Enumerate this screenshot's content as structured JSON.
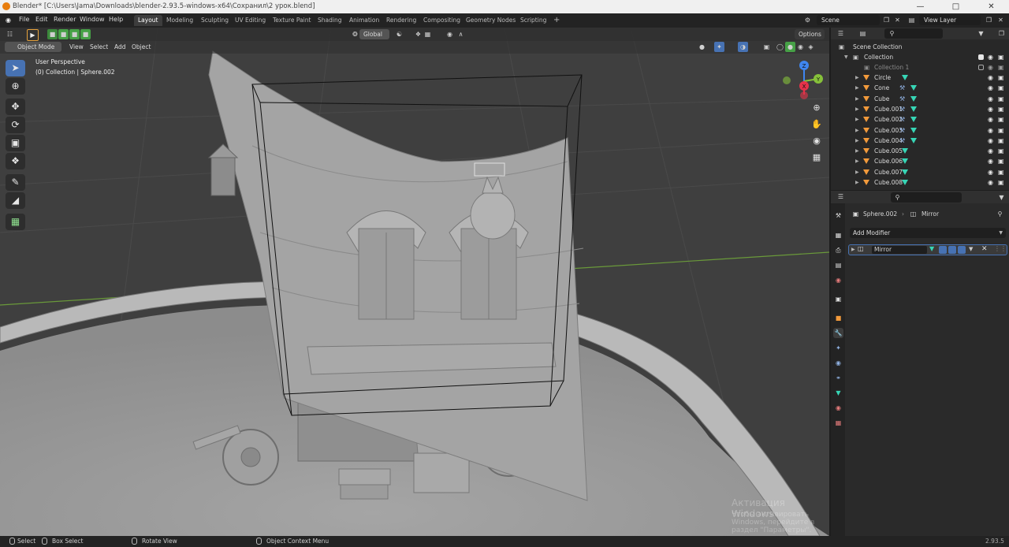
{
  "window": {
    "title": "Blender* [C:\\Users\\Jama\\Downloads\\blender-2.93.5-windows-x64\\Сохранил\\2 урок.blend]"
  },
  "menu": [
    "File",
    "Edit",
    "Render",
    "Window",
    "Help"
  ],
  "workspaces": [
    "Layout",
    "Modeling",
    "Sculpting",
    "UV Editing",
    "Texture Paint",
    "Shading",
    "Animation",
    "Rendering",
    "Compositing",
    "Geometry Nodes",
    "Scripting"
  ],
  "active_workspace": "Layout",
  "add_workspace": "+",
  "scene": {
    "label": "Scene",
    "view_layer": "View Layer"
  },
  "viewport": {
    "transform_orientation": "Global",
    "options_label": "Options",
    "mode": "Object Mode",
    "menus": [
      "View",
      "Select",
      "Add",
      "Object"
    ],
    "info_line1": "User Perspective",
    "info_line2": "(0) Collection | Sphere.002",
    "gizmo": {
      "x": "X",
      "y": "Y",
      "z": "Z"
    },
    "watermark_line1": "Активация Windows",
    "watermark_line2": "Чтобы активировать Windows, перейдите в раздел \"Параметры\"."
  },
  "outliner": {
    "search_placeholder": "",
    "scene_collection": "Scene Collection",
    "collection": "Collection",
    "collection1": "Collection 1",
    "objects": [
      {
        "name": "Circle",
        "modifier": false
      },
      {
        "name": "Cone",
        "modifier": true
      },
      {
        "name": "Cube",
        "modifier": true
      },
      {
        "name": "Cube.001",
        "modifier": true
      },
      {
        "name": "Cube.002",
        "modifier": true
      },
      {
        "name": "Cube.003",
        "modifier": true
      },
      {
        "name": "Cube.004",
        "modifier": true
      },
      {
        "name": "Cube.005",
        "modifier": false
      },
      {
        "name": "Cube.006",
        "modifier": false
      },
      {
        "name": "Cube.007",
        "modifier": false
      },
      {
        "name": "Cube.008",
        "modifier": false
      }
    ]
  },
  "properties": {
    "object_name": "Sphere.002",
    "modifier_context": "Mirror",
    "add_modifier": "Add Modifier",
    "modifier_name": "Mirror"
  },
  "statusbar": {
    "select": "Select",
    "box_select": "Box Select",
    "rotate_view": "Rotate View",
    "context_menu": "Object Context Menu",
    "version": "2.93.5"
  },
  "colors": {
    "accent": "#4772b3",
    "object_orange": "#f29a3b",
    "mesh_teal": "#37d6b6",
    "axis_x": "#e5334a",
    "axis_y": "#86c13a",
    "axis_z": "#3f86f0"
  }
}
